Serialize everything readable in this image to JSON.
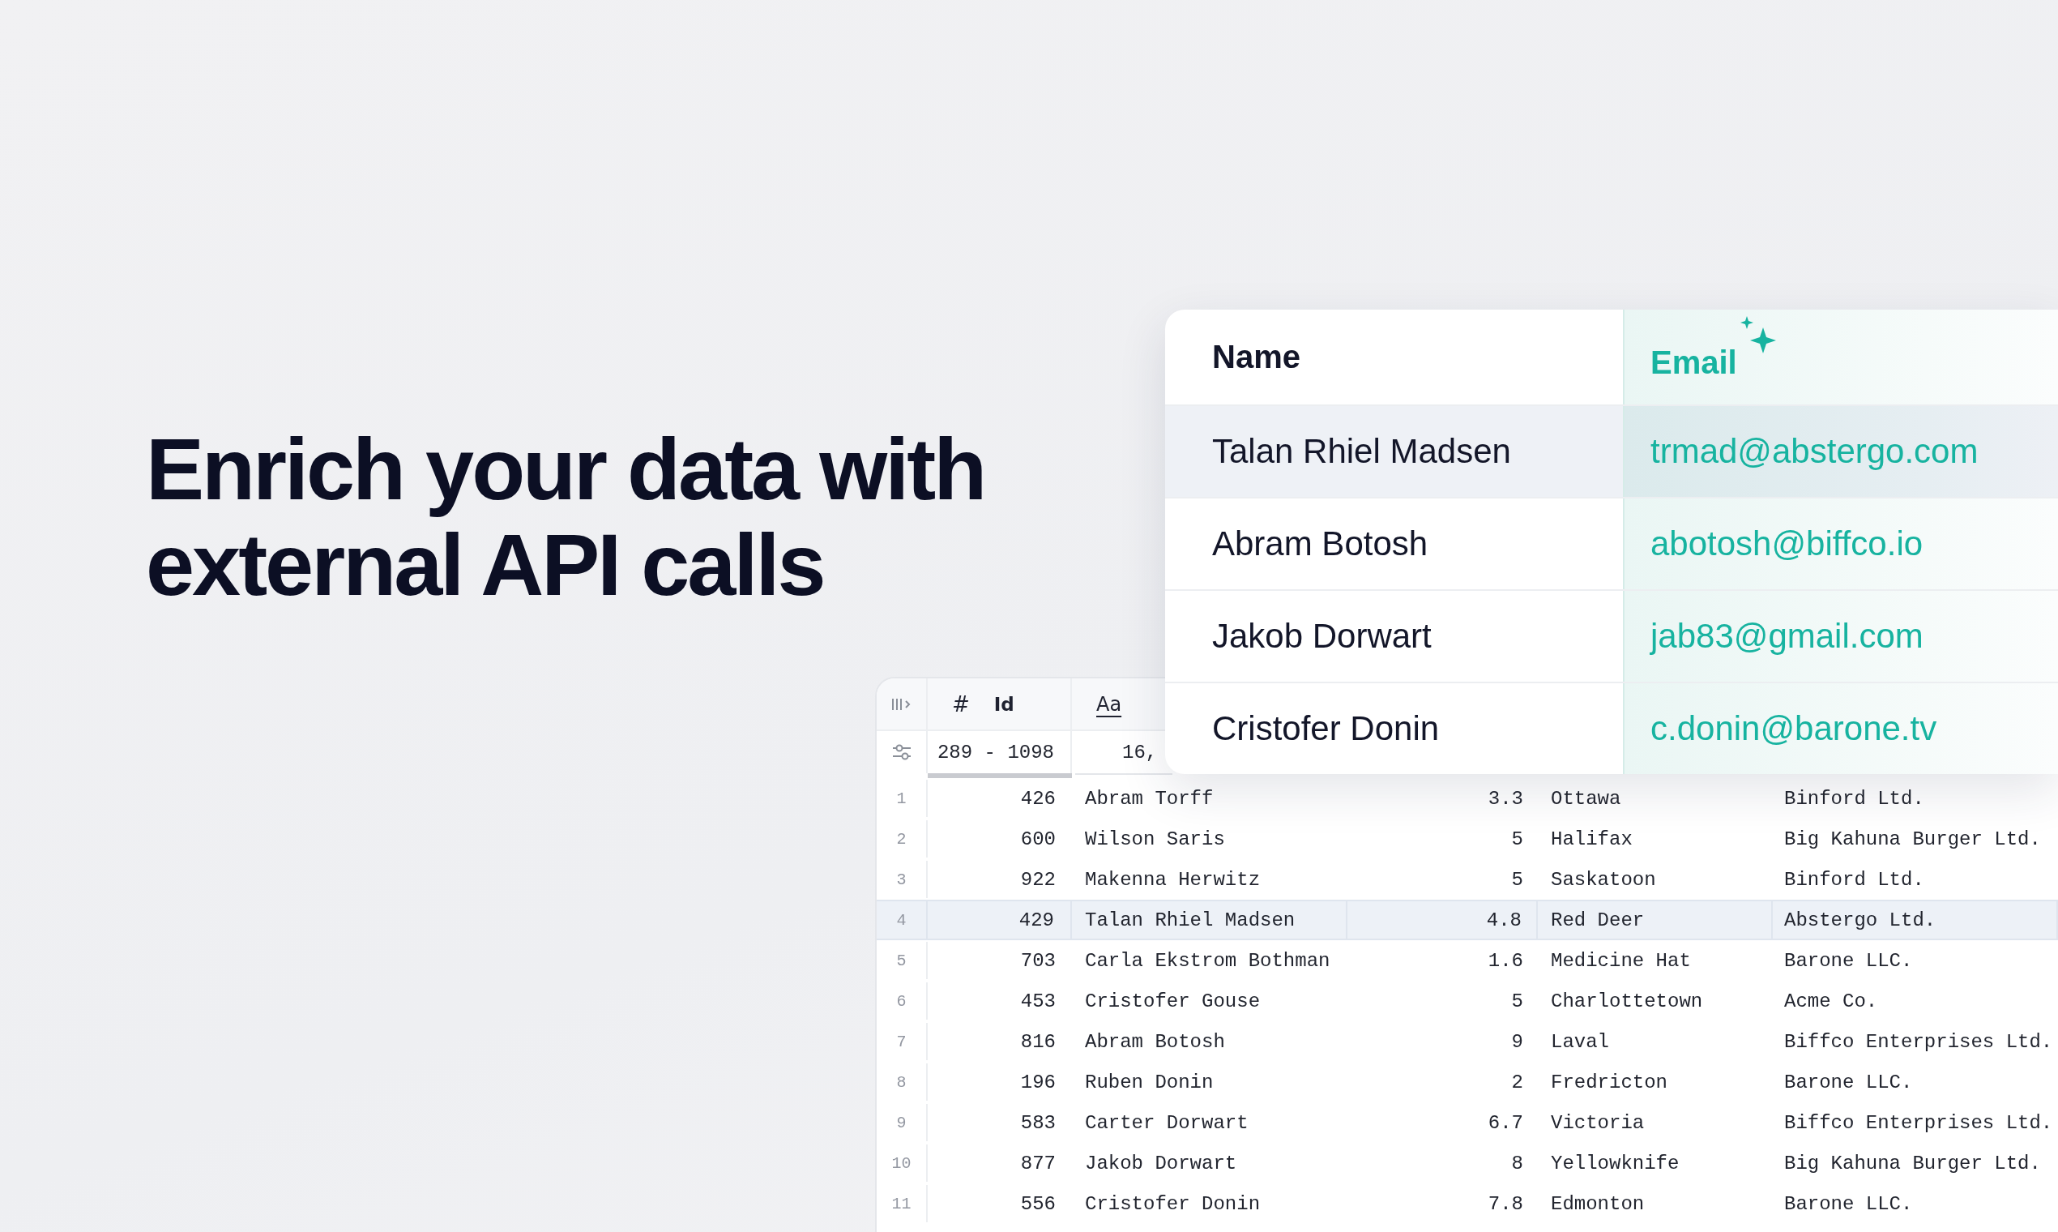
{
  "headline": "Enrich your data with external API calls",
  "grid": {
    "id_column": {
      "type_symbol": "#",
      "label": "Id"
    },
    "name_column": {
      "type_symbol": "Aa"
    },
    "id_filter": "289 - 1098",
    "name_filter": "16,",
    "rows": [
      {
        "number": "1",
        "id": "426",
        "name": "Abram Torff",
        "score": "3.3",
        "city": "Ottawa",
        "company": "Binford Ltd.",
        "selected": false
      },
      {
        "number": "2",
        "id": "600",
        "name": "Wilson Saris",
        "score": "5",
        "city": "Halifax",
        "company": "Big Kahuna Burger Ltd.",
        "selected": false
      },
      {
        "number": "3",
        "id": "922",
        "name": "Makenna Herwitz",
        "score": "5",
        "city": "Saskatoon",
        "company": "Binford Ltd.",
        "selected": false
      },
      {
        "number": "4",
        "id": "429",
        "name": "Talan Rhiel Madsen",
        "score": "4.8",
        "city": "Red Deer",
        "company": "Abstergo Ltd.",
        "selected": true
      },
      {
        "number": "5",
        "id": "703",
        "name": "Carla Ekstrom Bothman",
        "score": "1.6",
        "city": "Medicine Hat",
        "company": "Barone LLC.",
        "selected": false
      },
      {
        "number": "6",
        "id": "453",
        "name": "Cristofer Gouse",
        "score": "5",
        "city": "Charlottetown",
        "company": "Acme Co.",
        "selected": false
      },
      {
        "number": "7",
        "id": "816",
        "name": "Abram Botosh",
        "score": "9",
        "city": "Laval",
        "company": "Biffco Enterprises Ltd.",
        "selected": false
      },
      {
        "number": "8",
        "id": "196",
        "name": "Ruben Donin",
        "score": "2",
        "city": "Fredricton",
        "company": "Barone LLC.",
        "selected": false
      },
      {
        "number": "9",
        "id": "583",
        "name": "Carter Dorwart",
        "score": "6.7",
        "city": "Victoria",
        "company": "Biffco Enterprises Ltd.",
        "selected": false
      },
      {
        "number": "10",
        "id": "877",
        "name": "Jakob Dorwart",
        "score": "8",
        "city": "Yellowknife",
        "company": "Big Kahuna Burger Ltd.",
        "selected": false
      },
      {
        "number": "11",
        "id": "556",
        "name": "Cristofer Donin",
        "score": "7.8",
        "city": "Edmonton",
        "company": "Barone LLC.",
        "selected": false
      }
    ]
  },
  "card": {
    "columns": [
      {
        "label": "Name",
        "kind": "plain"
      },
      {
        "label": "Email",
        "kind": "enriched"
      }
    ],
    "rows": [
      {
        "name": "Talan Rhiel Madsen",
        "email": "trmad@abstergo.com",
        "selected": true
      },
      {
        "name": "Abram Botosh",
        "email": "abotosh@biffco.io",
        "selected": false
      },
      {
        "name": "Jakob Dorwart",
        "email": "jab83@gmail.com",
        "selected": false
      },
      {
        "name": "Cristofer Donin",
        "email": "c.donin@barone.tv",
        "selected": false
      }
    ]
  }
}
